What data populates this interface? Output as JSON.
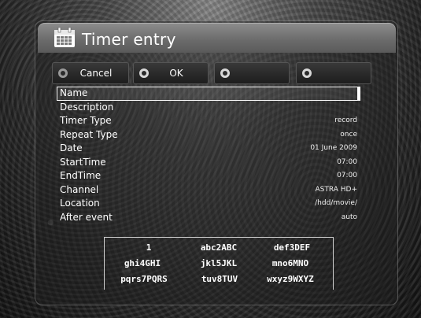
{
  "window": {
    "title": "Timer entry"
  },
  "buttons": [
    {
      "label": "Cancel",
      "color": "red"
    },
    {
      "label": "OK",
      "color": "green"
    },
    {
      "label": "",
      "color": "yellow"
    },
    {
      "label": "",
      "color": "blue"
    }
  ],
  "fields": [
    {
      "label": "Name",
      "value": ""
    },
    {
      "label": "Description",
      "value": ""
    },
    {
      "label": "Timer Type",
      "value": "record"
    },
    {
      "label": "Repeat Type",
      "value": "once"
    },
    {
      "label": "Date",
      "value": "01 June 2009"
    },
    {
      "label": "StartTime",
      "value": "07:00"
    },
    {
      "label": "EndTime",
      "value": "07:00"
    },
    {
      "label": "Channel",
      "value": "ASTRA HD+"
    },
    {
      "label": "Location",
      "value": "/hdd/movie/"
    },
    {
      "label": "After event",
      "value": "auto"
    }
  ],
  "keypad": [
    [
      "1",
      "abc2ABC",
      "def3DEF"
    ],
    [
      "ghi4GHI",
      "jkl5JKL",
      "mno6MNO"
    ],
    [
      "pqrs7PQRS",
      "tuv8TUV",
      "wxyz9WXYZ"
    ]
  ]
}
